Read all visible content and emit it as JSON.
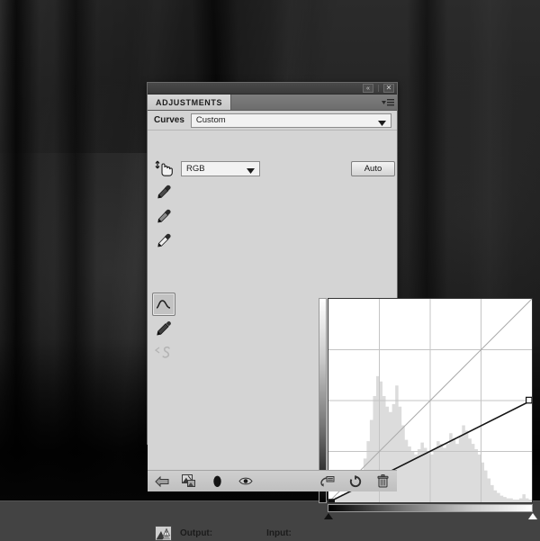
{
  "background": {
    "description": "dark-forest-photo",
    "desk_color": "#434343"
  },
  "panel": {
    "titlebar": {
      "collapse_label": "«",
      "close_label": "✕"
    },
    "tab_label": "ADJUSTMENTS",
    "menu_icon": "panel-menu-icon",
    "preset_row": {
      "label": "Curves",
      "value": "Custom",
      "caret": "▼"
    },
    "channel_row": {
      "value": "RGB",
      "caret": "▼",
      "auto_label": "Auto"
    },
    "tools": [
      {
        "name": "target-adjustment-tool",
        "icon": "hand-arrow-icon",
        "state": "normal"
      },
      {
        "name": "black-point-eyedropper",
        "icon": "eyedropper-icon",
        "state": "normal"
      },
      {
        "name": "gray-point-eyedropper",
        "icon": "eyedropper-icon",
        "state": "normal"
      },
      {
        "name": "white-point-eyedropper",
        "icon": "eyedropper-icon",
        "state": "normal"
      },
      {
        "name": "curve-point-tool",
        "icon": "curve-icon",
        "state": "selected"
      },
      {
        "name": "pencil-draw-tool",
        "icon": "pencil-icon",
        "state": "normal"
      },
      {
        "name": "smooth-curve-tool",
        "icon": "smooth-s-icon",
        "state": "disabled"
      }
    ],
    "io": {
      "clip-warning-icon": "clip-warning-icon",
      "output_label": "Output:",
      "output_value": "",
      "input_label": "Input:",
      "input_value": ""
    },
    "footer_buttons": [
      {
        "name": "return-to-adjustment-list-button",
        "icon": "back-arrow-icon"
      },
      {
        "name": "clip-to-layer-button",
        "icon": "clip-layer-icon"
      },
      {
        "name": "toggle-layer-mask-button",
        "icon": "black-ellipse-icon"
      },
      {
        "name": "toggle-layer-visibility-button",
        "icon": "eye-icon"
      },
      {
        "name": "view-previous-state-button",
        "icon": "previous-state-icon"
      },
      {
        "name": "reset-adjustment-button",
        "icon": "reset-circle-icon"
      },
      {
        "name": "delete-adjustment-layer-button",
        "icon": "trash-icon"
      }
    ]
  },
  "chart_data": {
    "type": "line",
    "title": "Curves RGB tone curve",
    "xlabel": "Input",
    "ylabel": "Output",
    "xlim": [
      0,
      255
    ],
    "ylim": [
      0,
      255
    ],
    "grid": true,
    "grid_divisions": 4,
    "baseline": {
      "name": "identity-diagonal",
      "points": [
        [
          0,
          0
        ],
        [
          255,
          255
        ]
      ]
    },
    "curve": {
      "name": "tone-curve",
      "points": [
        [
          0,
          0
        ],
        [
          255,
          128
        ]
      ],
      "control_points": [
        {
          "input": 0,
          "output": 0,
          "selected": true
        },
        {
          "input": 255,
          "output": 128,
          "selected": false
        }
      ]
    },
    "histogram": {
      "name": "rgb-histogram",
      "bins": 64,
      "values": [
        2,
        3,
        4,
        5,
        6,
        7,
        9,
        11,
        14,
        18,
        24,
        33,
        46,
        62,
        80,
        95,
        91,
        80,
        72,
        68,
        74,
        88,
        72,
        58,
        47,
        42,
        38,
        36,
        40,
        45,
        41,
        37,
        36,
        40,
        46,
        44,
        41,
        44,
        52,
        48,
        44,
        50,
        58,
        54,
        48,
        44,
        40,
        36,
        30,
        24,
        18,
        13,
        9,
        7,
        5,
        4,
        3,
        3,
        2,
        2,
        3,
        6,
        3,
        2
      ],
      "peak_bin": 15,
      "peak_value": 95
    },
    "gradients": {
      "vertical_ramp": "white-to-black",
      "horizontal_ramp": "black-to-white",
      "black_marker": 0,
      "white_marker": 255
    }
  }
}
